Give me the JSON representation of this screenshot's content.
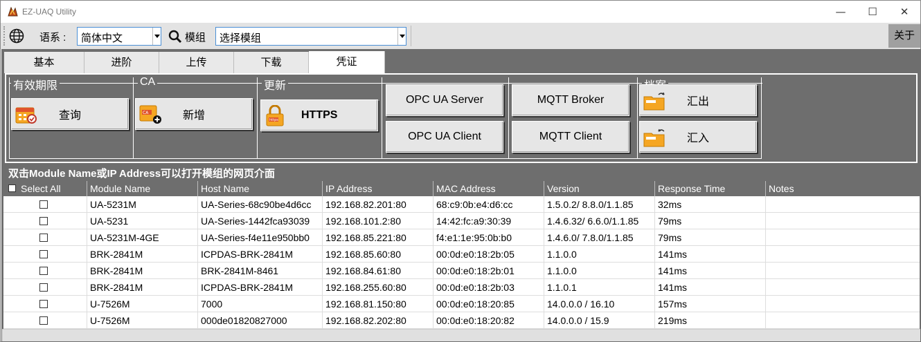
{
  "window": {
    "title": "EZ-UAQ Utility",
    "minimize": "—",
    "maximize": "☐",
    "close": "✕"
  },
  "toolbar": {
    "language_label": "语系 :",
    "language_value": "简体中文",
    "module_label": "模组",
    "module_value": "选择模组",
    "about_label": "关于"
  },
  "tabs": [
    "基本",
    "进阶",
    "上传",
    "下载",
    "凭证"
  ],
  "active_tab": "凭证",
  "groups": {
    "validity": {
      "label": "有效期限",
      "query_button": "查询"
    },
    "ca": {
      "label": "CA",
      "add_button": "新增"
    },
    "update": {
      "label": "更新",
      "https_button": "HTTPS",
      "opcua_server_button": "OPC UA Server",
      "opcua_client_button": "OPC UA Client",
      "mqtt_broker_button": "MQTT Broker",
      "mqtt_client_button": "MQTT Client"
    },
    "archive": {
      "label": "档案",
      "export_button": "汇出",
      "import_button": "汇入"
    }
  },
  "hint": "双击Module Name或IP Address可以打开模组的网页介面",
  "table": {
    "columns": [
      "Select All",
      "Module Name",
      "Host Name",
      "IP Address",
      "MAC Address",
      "Version",
      "Response Time",
      "Notes"
    ],
    "rows": [
      [
        "",
        "UA-5231M",
        "UA-Series-68c90be4d6cc",
        "192.168.82.201:80",
        "68:c9:0b:e4:d6:cc",
        "1.5.0.2/ 8.8.0/1.1.85",
        "32ms",
        ""
      ],
      [
        "",
        "UA-5231",
        "UA-Series-1442fca93039",
        "192.168.101.2:80",
        "14:42:fc:a9:30:39",
        "1.4.6.32/ 6.6.0/1.1.85",
        "79ms",
        ""
      ],
      [
        "",
        "UA-5231M-4GE",
        "UA-Series-f4e11e950bb0",
        "192.168.85.221:80",
        "f4:e1:1e:95:0b:b0",
        "1.4.6.0/ 7.8.0/1.1.85",
        "79ms",
        ""
      ],
      [
        "",
        "BRK-2841M",
        "ICPDAS-BRK-2841M",
        "192.168.85.60:80",
        "00:0d:e0:18:2b:05",
        "1.1.0.0",
        "141ms",
        ""
      ],
      [
        "",
        "BRK-2841M",
        "BRK-2841M-8461",
        "192.168.84.61:80",
        "00:0d:e0:18:2b:01",
        "1.1.0.0",
        "141ms",
        ""
      ],
      [
        "",
        "BRK-2841M",
        "ICPDAS-BRK-2841M",
        "192.168.255.60:80",
        "00:0d:e0:18:2b:03",
        "1.1.0.1",
        "141ms",
        ""
      ],
      [
        "",
        "U-7526M",
        "7000",
        "192.168.81.150:80",
        "00:0d:e0:18:20:85",
        "14.0.0.0 / 16.10",
        "157ms",
        ""
      ],
      [
        "",
        "U-7526M",
        "000de01820827000",
        "192.168.82.202:80",
        "00:0d:e0:18:20:82",
        "14.0.0.0 / 15.9",
        "219ms",
        ""
      ]
    ]
  },
  "colors": {
    "dark_bg": "#6e6e6e",
    "toolbar_bg": "#e3e3e3",
    "button_bg": "#e6e6e6",
    "icon_orange": "#f5a623",
    "accent_border": "#4a8fd6"
  }
}
